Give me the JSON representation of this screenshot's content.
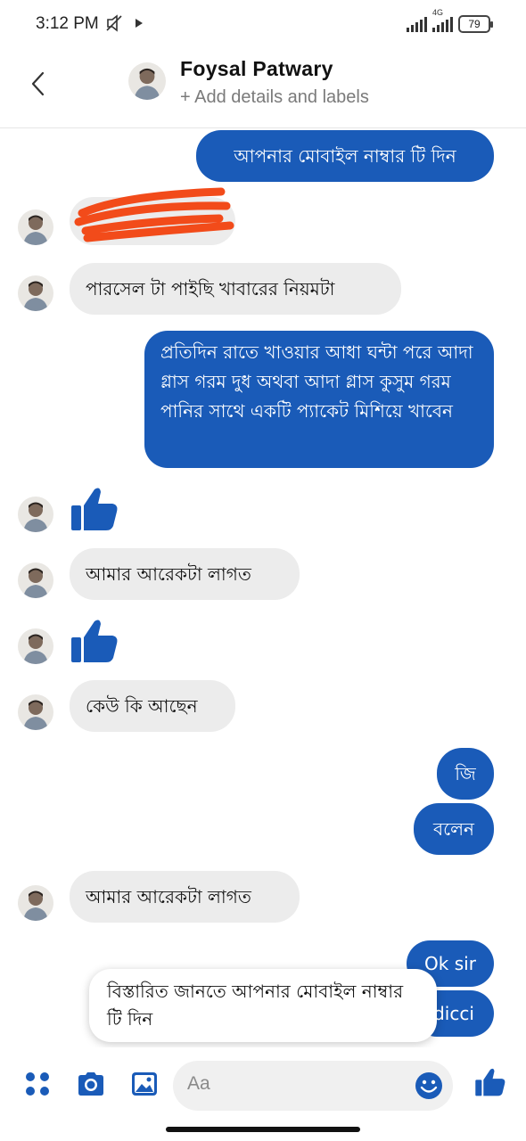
{
  "status": {
    "time": "3:12 PM",
    "left_icons": "✕⃠ ▸",
    "network": "4G",
    "battery": "79"
  },
  "header": {
    "name": "Foysal Patwary",
    "subtitle": "+ Add details and labels"
  },
  "messages": {
    "m1": "আপনার মোবাইল নাম্বার টি দিন",
    "m3": "পারসেল টা পাইছি খাবারের নিয়মটা",
    "m4": "প্রতিদিন রাতে খাওয়ার আধা ঘন্টা পরে আদা গ্লাস গরম দুধ অথবা আদা গ্লাস কুসুম গরম পানির সাথে একটি প্যাকেট মিশিয়ে খাবেন",
    "m6": "আমার আরেকটা লাগত",
    "m8": "কেউ কি আছেন",
    "m9": "জি",
    "m10": "বলেন",
    "m11": "আমার আরেকটা লাগত",
    "m12": "Ok sir",
    "m13": "dicci"
  },
  "tooltip": {
    "text": "বিস্তারিত জানতে আপনার মোবাইল নাম্বার টি দিন"
  },
  "composer": {
    "placeholder": "Aa"
  },
  "colors": {
    "accent": "#1a5bb8",
    "incoming": "#ececec",
    "scribble": "#f24b1a"
  },
  "icons": [
    "back-chevron-icon",
    "menu-dots-icon",
    "camera-icon",
    "gallery-icon",
    "emoji-icon",
    "like-icon",
    "thumbs-up-icon"
  ]
}
